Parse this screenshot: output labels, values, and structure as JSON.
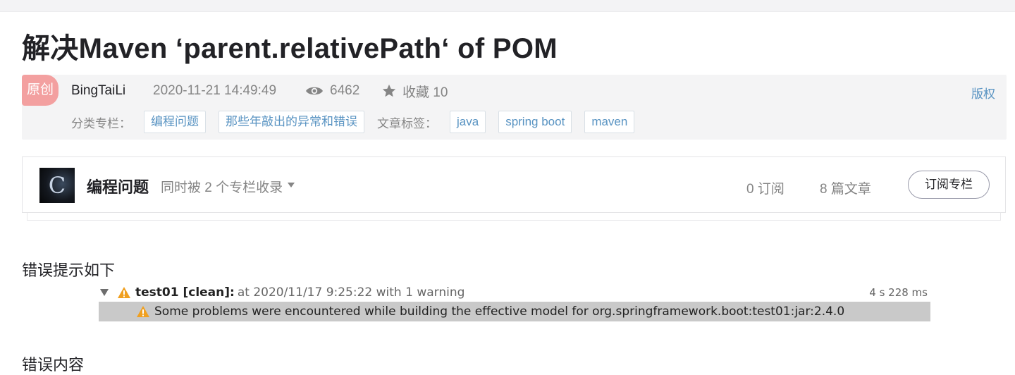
{
  "article": {
    "title": "解决Maven ‘parent.relativePath‘ of POM"
  },
  "meta": {
    "badge": "原创",
    "author": "BingTaiLi",
    "date": "2020-11-21 14:49:49",
    "views": "6462",
    "collect": "收藏 10",
    "copyright": "版权",
    "category_label": "分类专栏：",
    "categories": [
      "编程问题",
      "那些年敲出的异常和错误"
    ],
    "tags_label": "文章标签：",
    "tags": [
      "java",
      "spring boot",
      "maven"
    ]
  },
  "column": {
    "thumb_letter": "C",
    "name": "编程问题",
    "included": "同时被 2 个专栏收录",
    "subscriptions": "0 订阅",
    "articles": "8 篇文章",
    "subscribe_label": "订阅专栏"
  },
  "content": {
    "heading1": "错误提示如下",
    "heading2": "错误内容"
  },
  "console": {
    "task": "test01 [clean]:",
    "rest": "at 2020/11/17 9:25:22 with 1 warning",
    "time": "4 s 228 ms",
    "message": "Some problems were encountered while building the effective model for org.springframework.boot:test01:jar:2.4.0"
  },
  "colors": {
    "badge": "#f3a0a0",
    "link": "#5893c2",
    "warning": "#f0a020"
  }
}
